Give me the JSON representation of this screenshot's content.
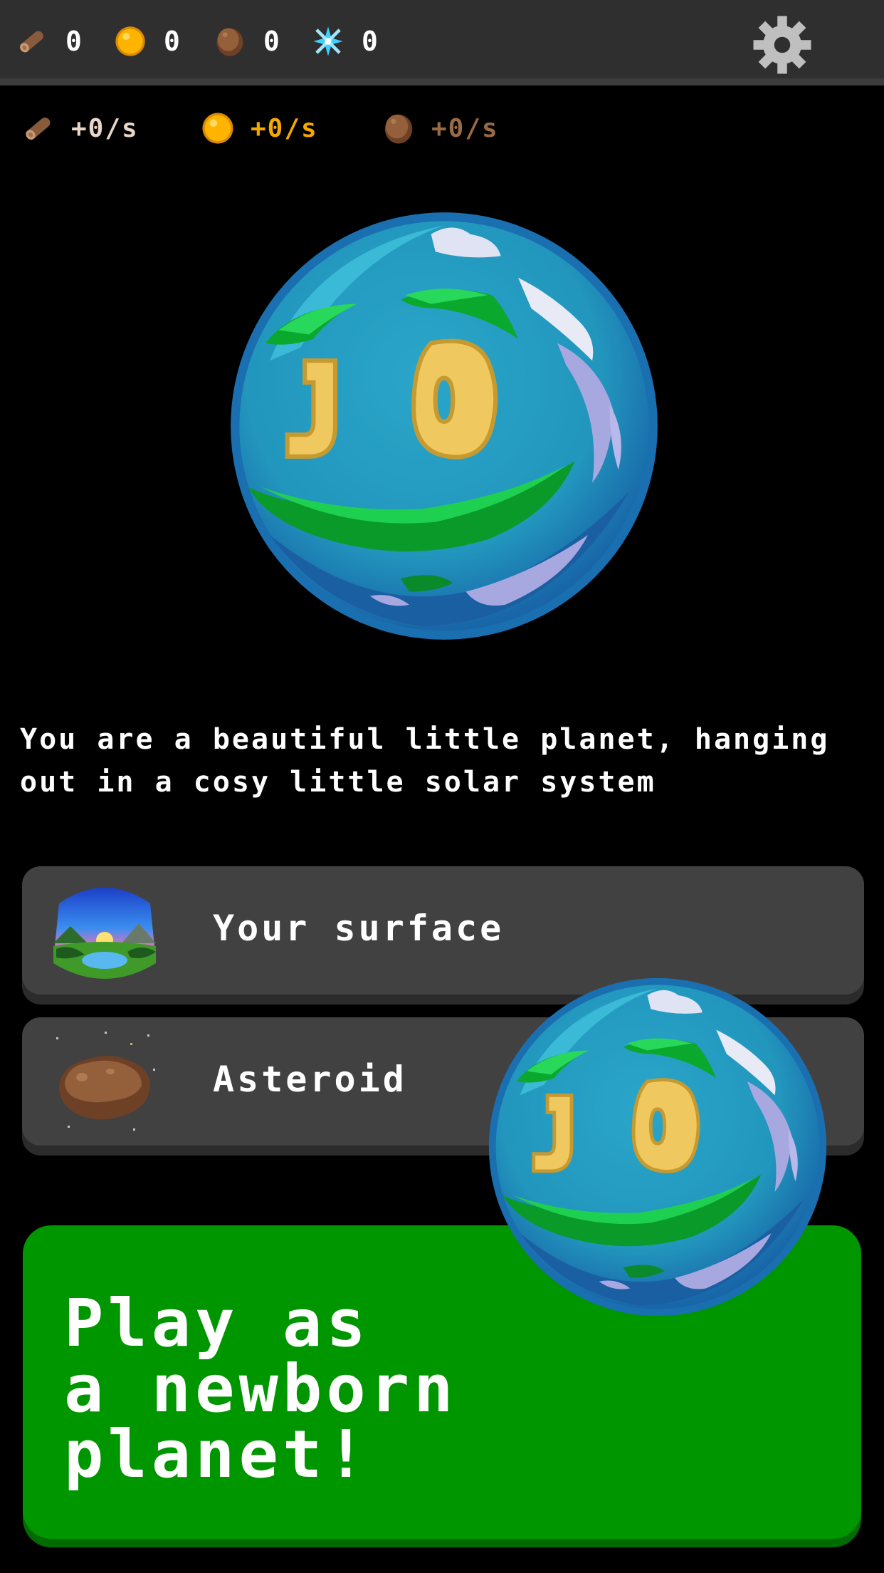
{
  "resources": {
    "wood": "0",
    "gold": "0",
    "rock": "0",
    "crystal": "0"
  },
  "rates": {
    "wood": "+0/s",
    "gold": "+0/s",
    "rock": "+0/s"
  },
  "description": "You are a beautiful little planet, hanging out in a cosy little solar system",
  "cards": {
    "surface_label": "Your surface",
    "asteroid_label": "Asteroid"
  },
  "play": {
    "line1": "Play as",
    "line2": "a newborn",
    "line3": "planet!"
  },
  "colors": {
    "background": "#000000",
    "topbar": "#2f2f2f",
    "card": "#414141",
    "play_button": "#009600",
    "gold_text": "#f5a800",
    "rock_text": "#9a6a44"
  },
  "icons": [
    "wood-log-icon",
    "gold-coin-icon",
    "rock-icon",
    "crystal-icon",
    "gear-icon"
  ]
}
